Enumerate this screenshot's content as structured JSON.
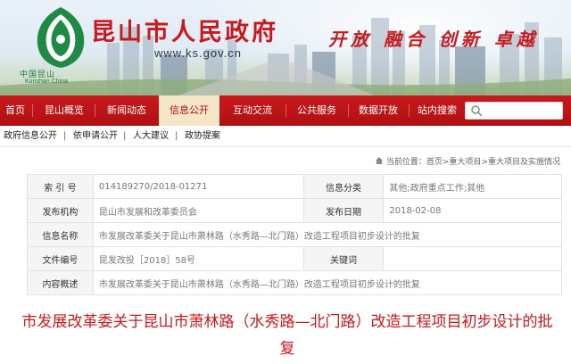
{
  "banner": {
    "site_title": "昆山市人民政府",
    "site_url": "www.ks.gov.cn",
    "slogan": "开放 融合 创新 卓越",
    "logo_text_cn": "中国昆山",
    "logo_text_en": "Kunshan China"
  },
  "nav": {
    "items": [
      {
        "label": "首页"
      },
      {
        "label": "昆山概览"
      },
      {
        "label": "新闻动态"
      },
      {
        "label": "信息公开",
        "active": true
      },
      {
        "label": "互动交流"
      },
      {
        "label": "公共服务"
      },
      {
        "label": "数据开放"
      },
      {
        "label": "站内搜索"
      }
    ],
    "search_placeholder": ""
  },
  "subnav": {
    "items": [
      "政府信息公开",
      "依申请公开",
      "人大建议",
      "政协提案"
    ],
    "separator": "|"
  },
  "breadcrumb": {
    "prefix": "当前位置：",
    "items": [
      "首页",
      "重大项目",
      "重大项目及实施情况"
    ],
    "separator": ">"
  },
  "info": {
    "rows": [
      {
        "label1": "索 引 号",
        "value1": "014189270/2018-01271",
        "label2": "信息分类",
        "value2": "其他;政府重点工作;其他"
      },
      {
        "label1": "发布机构",
        "value1": "昆山市发展和改革委员会",
        "label2": "发布日期",
        "value2": "2018-02-08"
      },
      {
        "label1": "信息名称",
        "value1": "市发展改革委关于昆山市萧林路（水秀路—北门路）改造工程项目初步设计的批复"
      },
      {
        "label1": "文件编号",
        "value1": "昆发改投［2018］58号",
        "label2": "关键词",
        "value2": ""
      },
      {
        "label1": "内容概述",
        "value1": "市发展改革委关于昆山市萧林路（水秀路—北门路）改造工程项目初步设计的批复"
      }
    ]
  },
  "article": {
    "title": "市发展改革委关于昆山市萧林路（水秀路—北门路）改造工程项目初步设计的批复"
  },
  "colors": {
    "brand_red": "#c8191d",
    "nav_red": "#b00f12",
    "active_tab_bg": "#f4e6c6",
    "logo_green": "#1e7a3c"
  }
}
